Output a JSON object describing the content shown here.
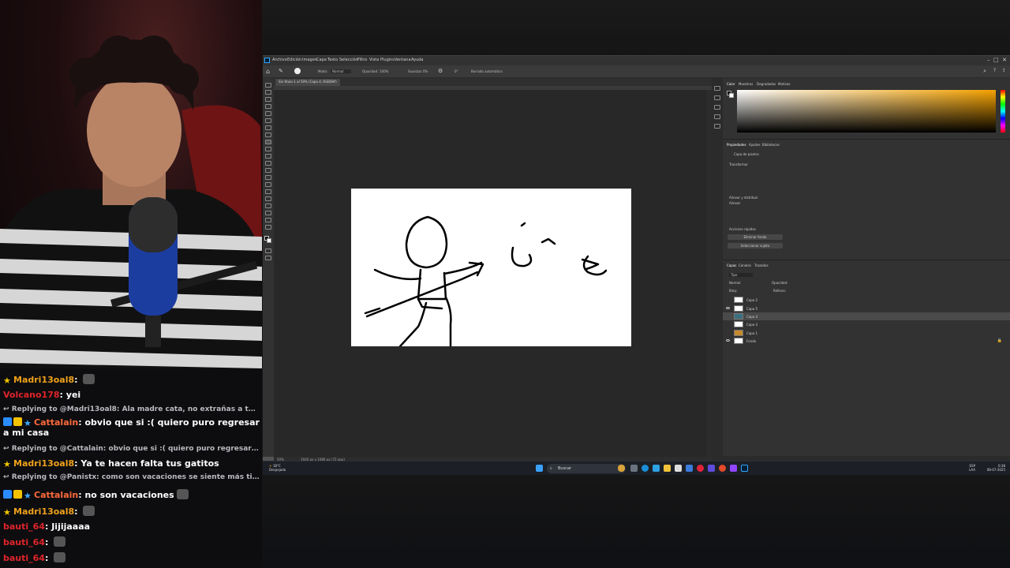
{
  "chat": {
    "messages": [
      {
        "type": "msg",
        "user": "Madri13oal8",
        "user_color": "#f0a21b",
        "text": "",
        "emote": true
      },
      {
        "type": "msg",
        "user": "Volcano178",
        "user_color": "#e0242a",
        "text": "yei"
      },
      {
        "type": "reply",
        "text": "Replying to @Madri13oal8: Ala madre cata, no extrañas a tu ca..."
      },
      {
        "type": "msg",
        "user": "Cattalain",
        "user_color": "#ff6a3d",
        "text": "obvio que si :( quiero puro regresar a mi casa"
      },
      {
        "type": "reply",
        "text": "Replying to @Cattalain: obvio que si :( quiero puro regresar a mi..."
      },
      {
        "type": "msg",
        "user": "Madri13oal8",
        "user_color": "#f0a21b",
        "text": "Ya te hacen falta tus gatitos"
      },
      {
        "type": "reply",
        "text": "Replying to @Panistx: como son vacaciones se siente más tiem..."
      },
      {
        "type": "msg",
        "user": "Cattalain",
        "user_color": "#ff6a3d",
        "text": "no son vacaciones",
        "emote": true
      },
      {
        "type": "msg",
        "user": "Madri13oal8",
        "user_color": "#f0a21b",
        "text": "",
        "emote": true
      },
      {
        "type": "msg",
        "user": "bauti_64",
        "user_color": "#e0242a",
        "text": "Jijijaaaa"
      },
      {
        "type": "msg",
        "user": "bauti_64",
        "user_color": "#e0242a",
        "text": "",
        "emote": true
      },
      {
        "type": "msg",
        "user": "bauti_64",
        "user_color": "#e0242a",
        "text": "",
        "emote": true
      }
    ]
  },
  "photoshop": {
    "menu": [
      "Archivo",
      "Edición",
      "Imagen",
      "Capa",
      "Texto",
      "Selección",
      "Filtro",
      "Vista",
      "Plugins",
      "Ventana",
      "Ayuda"
    ],
    "options": {
      "mode_label": "Modo:",
      "mode_value": "Normal",
      "opacity_label": "Opacidad:",
      "opacity_value": "100%",
      "smooth_label": "Suavizar:",
      "smooth_value": "0%",
      "angle_value": "0°",
      "auto_erase": "Borrado automático"
    },
    "doc_tab": "Sin título-1 al 50% (Capa 4, RGB/8#)",
    "status": {
      "zoom": "50%",
      "info": "1920 px x 1080 px (72 ppp)"
    },
    "panels": {
      "color_tabs": [
        "Color",
        "Muestras",
        "Degradados",
        "Motivos"
      ],
      "props_tabs": [
        "Propiedades",
        "Ajustes",
        "Bibliotecas"
      ],
      "props_kind": "Capa de píxeles",
      "transform_label": "Transformar",
      "align_label": "Alinear y distribuir",
      "align_sub": "Alinear:",
      "quick_label": "Acciones rápidas",
      "btn_remove_bg": "Eliminar fondo",
      "btn_select_subject": "Seleccionar sujeto",
      "layers_tabs": [
        "Capas",
        "Canales",
        "Trazados"
      ],
      "kind_filter": "Tipo",
      "mode": "Normal",
      "opacity_label": "Opacidad:",
      "lock_label": "Bloq:",
      "fill_label": "Relleno:",
      "layers": [
        "Capa 2",
        "Capa 5",
        "Capa 4",
        "Capa 3",
        "Capa 1",
        "Fondo"
      ]
    },
    "accent_color": "#f5a200"
  },
  "taskbar": {
    "weather_temp": "18°C",
    "weather_desc": "Despejado",
    "search_placeholder": "Buscar",
    "lang_top": "ESP",
    "lang_bottom": "LAA",
    "time": "0:38",
    "date": "08-07-2025"
  }
}
